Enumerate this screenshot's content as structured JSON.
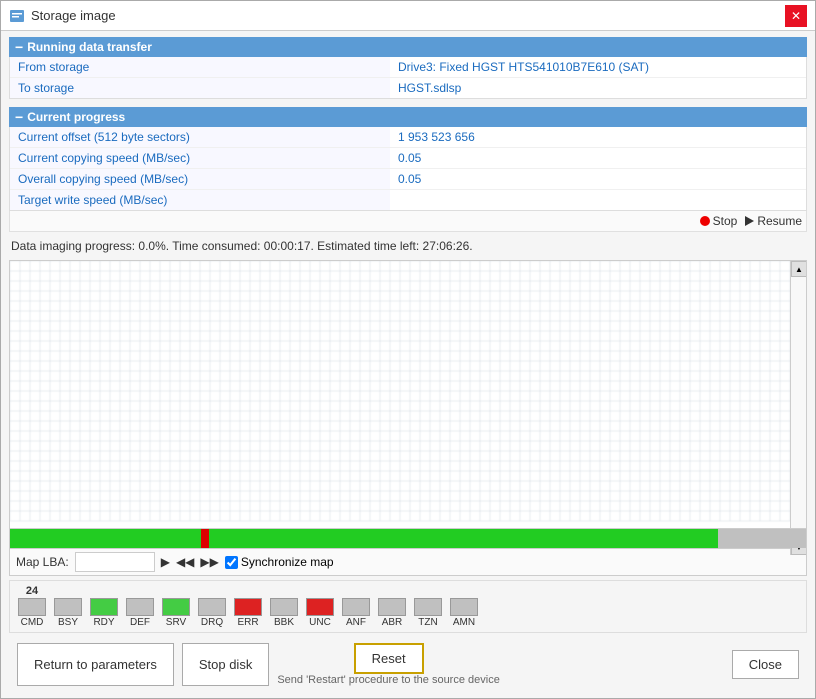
{
  "window": {
    "title": "Storage image",
    "close_label": "✕"
  },
  "running_transfer": {
    "header": "Running data transfer",
    "from_label": "From storage",
    "from_value": "Drive3: Fixed HGST HTS541010B7E610 (SAT)",
    "to_label": "To storage",
    "to_value": "HGST.sdlsp"
  },
  "current_progress": {
    "header": "Current progress",
    "rows": [
      {
        "label": "Current offset (512 byte sectors)",
        "value": "1 953 523 656"
      },
      {
        "label": "Current copying speed (MB/sec)",
        "value": "0.05"
      },
      {
        "label": "Overall copying speed (MB/sec)",
        "value": "0.05"
      },
      {
        "label": "Target write speed (MB/sec)",
        "value": ""
      }
    ]
  },
  "controls": {
    "stop_label": "Stop",
    "resume_label": "Resume"
  },
  "status_text": "Data imaging progress: 0.0%. Time consumed: 00:00:17. Estimated time left: 27:06:26.",
  "map": {
    "lba_label": "Map LBA:",
    "lba_value": "",
    "lba_placeholder": "",
    "sync_label": "Synchronize map"
  },
  "legend": {
    "cmd_count": "24",
    "items": [
      {
        "id": "CMD",
        "label": "CMD",
        "color": "#c0c0c0",
        "count": "24"
      },
      {
        "id": "BSY",
        "label": "BSY",
        "color": "#c0c0c0",
        "count": ""
      },
      {
        "id": "RDY",
        "label": "RDY",
        "color": "#44cc44",
        "count": ""
      },
      {
        "id": "DEF",
        "label": "DEF",
        "color": "#c0c0c0",
        "count": ""
      },
      {
        "id": "SRV",
        "label": "SRV",
        "color": "#44cc44",
        "count": ""
      },
      {
        "id": "DRQ",
        "label": "DRQ",
        "color": "#c0c0c0",
        "count": ""
      },
      {
        "id": "ERR",
        "label": "ERR",
        "color": "#dd2222",
        "count": ""
      },
      {
        "id": "BBK",
        "label": "BBK",
        "color": "#c0c0c0",
        "count": ""
      },
      {
        "id": "UNC",
        "label": "UNC",
        "color": "#dd2222",
        "count": ""
      },
      {
        "id": "ANF",
        "label": "ANF",
        "color": "#c0c0c0",
        "count": ""
      },
      {
        "id": "ABR",
        "label": "ABR",
        "color": "#c0c0c0",
        "count": ""
      },
      {
        "id": "TZN",
        "label": "TZN",
        "color": "#c0c0c0",
        "count": ""
      },
      {
        "id": "AMN",
        "label": "AMN",
        "color": "#c0c0c0",
        "count": ""
      }
    ]
  },
  "buttons": {
    "return_label": "Return to parameters",
    "stop_disk_label": "Stop disk",
    "reset_label": "Reset",
    "reset_tooltip": "Send 'Restart' procedure to the source device",
    "close_label": "Close"
  }
}
